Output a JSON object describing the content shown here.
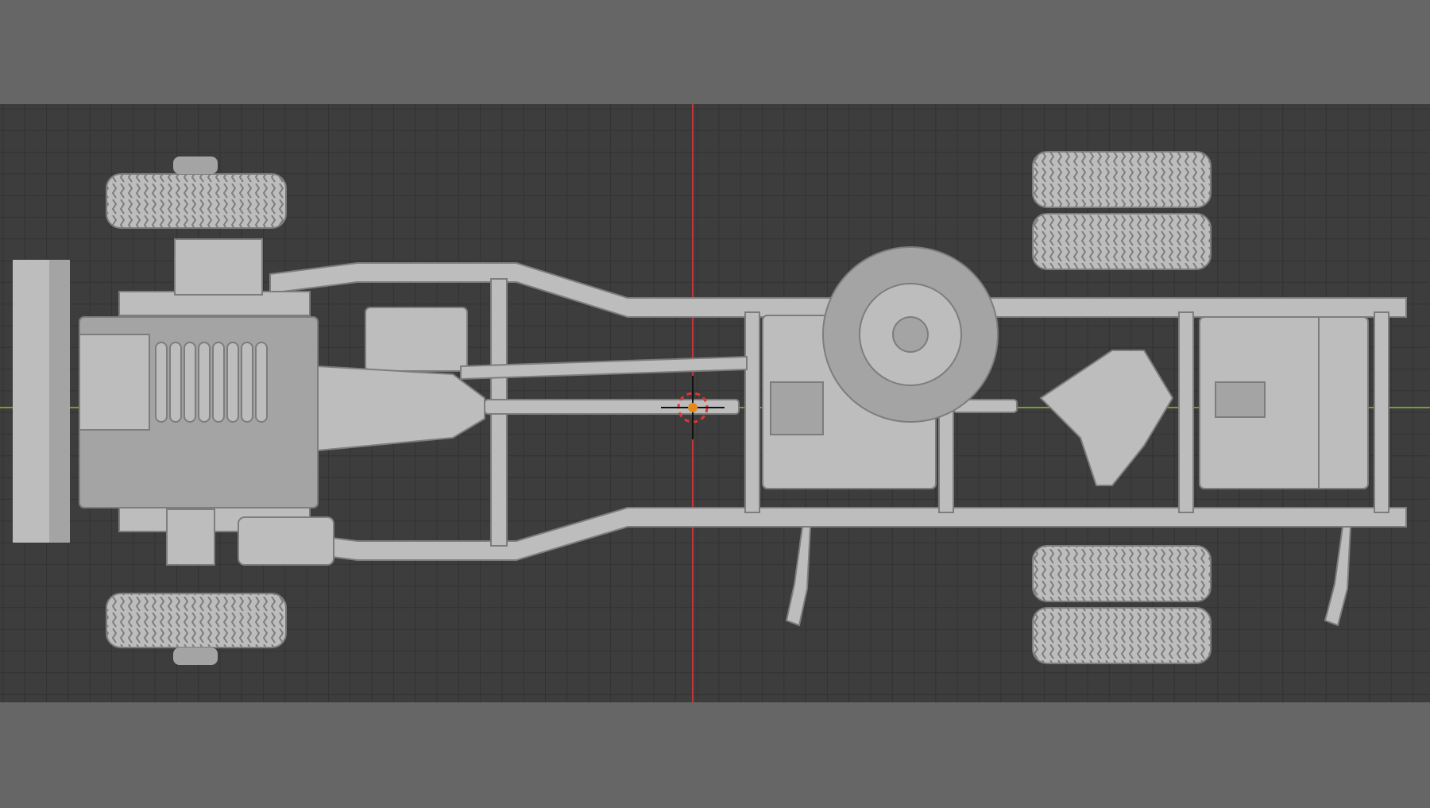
{
  "colors": {
    "letterbox": "#666666",
    "viewport_background": "#3d3d3d",
    "grid_minor": "#333333",
    "grid_major": "#2d2d2d",
    "axis_x": "#7a9c2e",
    "axis_y": "#c4353a",
    "model_light": "#bdbdbd",
    "model_mid": "#a4a4a4",
    "model_dark": "#7d7d7d",
    "model_shadow": "#5e5e5e",
    "origin_marker": "#e38a1f",
    "cursor_ring_red": "#d73a32",
    "cursor_ring_white": "#ffffff"
  },
  "viewport": {
    "view": "top-orthographic",
    "model": "truck-chassis"
  },
  "icons": {
    "origin": "origin-dot-icon",
    "cursor": "3d-cursor-icon"
  }
}
